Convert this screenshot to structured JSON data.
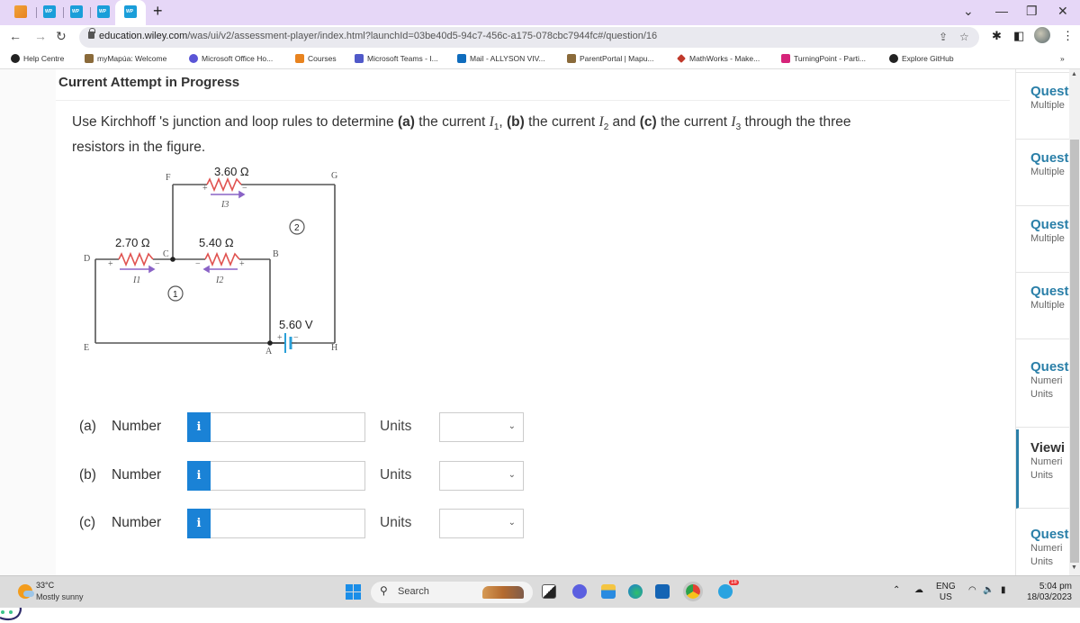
{
  "browser": {
    "tabs": [
      {
        "name": "courses-tab",
        "icon": "courses-icon"
      },
      {
        "name": "wp-tab",
        "icon": "wp-icon"
      },
      {
        "name": "wp-tab",
        "icon": "wp-icon"
      },
      {
        "name": "wp-tab",
        "icon": "wp-icon"
      },
      {
        "name": "wp-tab-active",
        "icon": "wp-icon"
      }
    ],
    "new_tab": "+",
    "url_host": "education.wiley.com",
    "url_path": "/was/ui/v2/assessment-player/index.html?launchId=03be40d5-94c7-456c-a175-078cbc7944fc#/question/16",
    "bookmarks": [
      {
        "label": "Help Centre",
        "color": "#222222"
      },
      {
        "label": "myMapúa: Welcome",
        "color": "#8a6a3a"
      },
      {
        "label": "Microsoft Office Ho...",
        "color": "#5a55d6"
      },
      {
        "label": "Courses",
        "color": "#e8831f"
      },
      {
        "label": "Microsoft Teams - I...",
        "color": "#5059c9"
      },
      {
        "label": "Mail - ALLYSON VIV...",
        "color": "#0f6cbd"
      },
      {
        "label": "ParentPortal | Mapu...",
        "color": "#8a6a3a"
      },
      {
        "label": "MathWorks - Make...",
        "color": "#c0392b"
      },
      {
        "label": "TurningPoint - Parti...",
        "color": "#d6247a"
      },
      {
        "label": "Explore GitHub",
        "color": "#222222"
      }
    ],
    "bookmarks_overflow": "»"
  },
  "page": {
    "attempt_title": "Current Attempt in Progress",
    "question": {
      "text_1": "Use Kirchhoff 's junction and loop rules to determine ",
      "part_a": "(a)",
      "text_2": " the current ",
      "i1": "I",
      "i1_sub": "1",
      "text_3": ", ",
      "part_b": "(b)",
      "text_4": " the current ",
      "i2": "I",
      "i2_sub": "2",
      "text_5": " and ",
      "part_c": "(c)",
      "text_6": " the current ",
      "i3": "I",
      "i3_sub": "3",
      "text_7": " through the three resistors in the figure."
    },
    "circuit": {
      "r1": "2.70 Ω",
      "r2": "5.40 Ω",
      "r3": "3.60 Ω",
      "battery": "5.60 V",
      "nodes": [
        "A",
        "B",
        "C",
        "D",
        "E",
        "F",
        "G",
        "H"
      ],
      "currents": [
        "I1",
        "I2",
        "I3"
      ],
      "loops": [
        "1",
        "2"
      ],
      "plus": "+",
      "minus": "−"
    },
    "answers": [
      {
        "part": "(a)",
        "label": "Number",
        "value": "",
        "units_label": "Units",
        "units_value": ""
      },
      {
        "part": "(b)",
        "label": "Number",
        "value": "",
        "units_label": "Units",
        "units_value": ""
      },
      {
        "part": "(c)",
        "label": "Number",
        "value": "",
        "units_label": "Units",
        "units_value": ""
      }
    ],
    "info_icon": "i"
  },
  "right_panel": {
    "items": [
      {
        "title": "Questi",
        "sub": [
          "Multiple"
        ]
      },
      {
        "title": "Questi",
        "sub": [
          "Multiple"
        ]
      },
      {
        "title": "Questi",
        "sub": [
          "Multiple"
        ]
      },
      {
        "title": "Questi",
        "sub": [
          "Multiple"
        ]
      },
      {
        "title": "Questi",
        "sub": [
          "Numeri",
          "Units"
        ]
      },
      {
        "title": "Viewi",
        "sub": [
          "Numeri",
          "Units"
        ],
        "active": true
      },
      {
        "title": "Questi",
        "sub": [
          "Numeri",
          "Units"
        ]
      }
    ]
  },
  "taskbar": {
    "weather_temp": "33°C",
    "weather_desc": "Mostly sunny",
    "search_label": "Search",
    "lang_1": "ENG",
    "lang_2": "US",
    "time": "5:04 pm",
    "date": "18/03/2023",
    "telegram_badge": "18"
  },
  "colors": {
    "accent": "#1a82d6",
    "question_link": "#2a7fa8",
    "tabstrip": "#e6d7f7",
    "resistor": "#e0524f",
    "current_arrow": "#8a63c6",
    "battery": "#2aa0d8"
  }
}
